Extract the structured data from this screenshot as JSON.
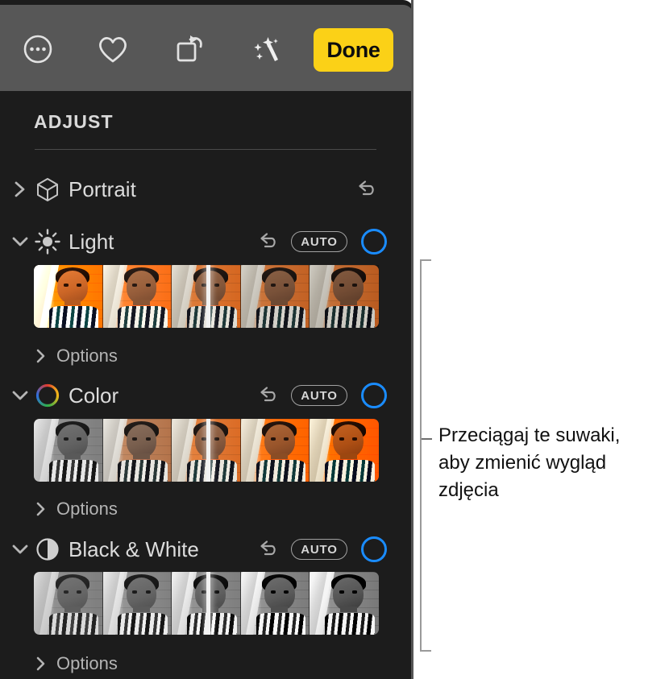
{
  "toolbar": {
    "more_icon": "more-ellipsis-icon",
    "favorite_icon": "heart-icon",
    "rotate_icon": "rotate-icon",
    "enhance_icon": "magic-wand-icon",
    "done_label": "Done",
    "done_color": "#fbd117",
    "background": "#575757"
  },
  "panel": {
    "title": "ADJUST",
    "background": "#1c1c1c",
    "accent_blue": "#1a8cff",
    "auto_label": "AUTO",
    "options_label": "Options",
    "revert_icon": "undo-arrow-icon",
    "expand_icon": "chevron-right-icon",
    "collapse_icon": "chevron-down-icon"
  },
  "sections": [
    {
      "id": "portrait",
      "label": "Portrait",
      "icon": "cube-icon",
      "expanded": false,
      "chevron": "chevron-right-icon",
      "has_auto": false,
      "has_toggle": false,
      "has_revert": true,
      "has_filmstrip": false,
      "has_options": false
    },
    {
      "id": "light",
      "label": "Light",
      "icon": "sun-icon",
      "expanded": true,
      "chevron": "chevron-down-icon",
      "has_auto": true,
      "has_toggle": true,
      "has_revert": true,
      "has_filmstrip": true,
      "has_options": true,
      "filmstrip": {
        "slider_position_percent": 50,
        "frames": [
          {
            "brightness": 1.22,
            "saturate": 1.55,
            "contrast": 1.12
          },
          {
            "brightness": 1.06,
            "saturate": 1.12,
            "contrast": 1.02
          },
          {
            "brightness": 0.96,
            "saturate": 0.98,
            "contrast": 0.98
          },
          {
            "brightness": 0.9,
            "saturate": 0.92,
            "contrast": 1.0
          },
          {
            "brightness": 0.86,
            "saturate": 0.9,
            "contrast": 1.04
          }
        ]
      }
    },
    {
      "id": "color",
      "label": "Color",
      "icon": "color-wheel-icon",
      "expanded": true,
      "chevron": "chevron-down-icon",
      "has_auto": true,
      "has_toggle": true,
      "has_revert": true,
      "has_filmstrip": true,
      "has_options": true,
      "filmstrip": {
        "slider_position_percent": 50,
        "frames": [
          {
            "brightness": 1.0,
            "saturate": 0.0,
            "contrast": 1.0
          },
          {
            "brightness": 1.0,
            "saturate": 0.55,
            "contrast": 1.0
          },
          {
            "brightness": 1.0,
            "saturate": 0.95,
            "contrast": 1.0
          },
          {
            "brightness": 1.0,
            "saturate": 1.35,
            "contrast": 1.05
          },
          {
            "brightness": 1.0,
            "saturate": 1.8,
            "contrast": 1.1
          }
        ]
      }
    },
    {
      "id": "black-and-white",
      "label": "Black & White",
      "icon": "contrast-half-circle-icon",
      "expanded": true,
      "chevron": "chevron-down-icon",
      "has_auto": true,
      "has_toggle": true,
      "has_revert": true,
      "has_filmstrip": true,
      "has_options": true,
      "filmstrip": {
        "slider_position_percent": 50,
        "frames": [
          {
            "brightness": 1.0,
            "saturate": 0.0,
            "contrast": 0.88
          },
          {
            "brightness": 1.02,
            "saturate": 0.0,
            "contrast": 1.0
          },
          {
            "brightness": 1.0,
            "saturate": 0.0,
            "contrast": 1.1
          },
          {
            "brightness": 0.98,
            "saturate": 0.0,
            "contrast": 1.22
          },
          {
            "brightness": 0.96,
            "saturate": 0.0,
            "contrast": 1.35
          }
        ]
      }
    }
  ],
  "callout": {
    "text": "Przeciągaj te suwaki,\naby zmienić wygląd\nzdjęcia",
    "bracket_color": "#9a9a9a"
  }
}
